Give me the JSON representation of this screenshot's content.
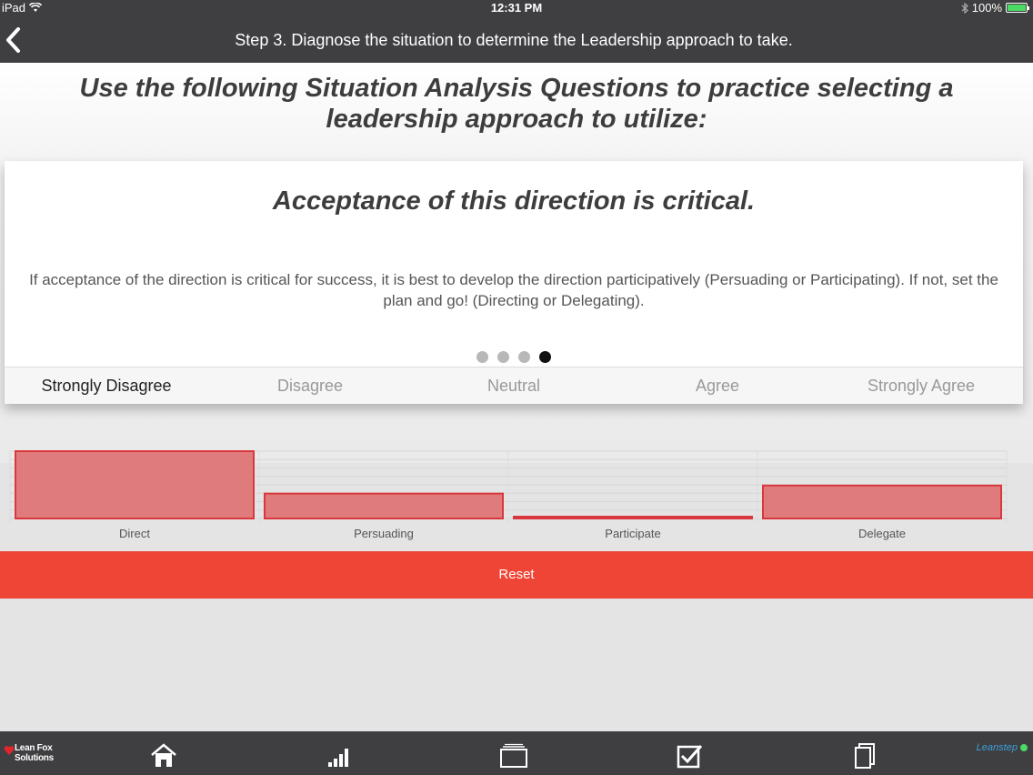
{
  "status_bar": {
    "device": "iPad",
    "time": "12:31 PM",
    "battery": "100%"
  },
  "nav": {
    "title": "Step 3. Diagnose the situation to determine the Leadership approach to take."
  },
  "headline": "Use the following Situation Analysis Questions to practice selecting a leadership approach to utilize:",
  "card": {
    "title": "Acceptance of this direction is critical.",
    "body": "If acceptance of the direction is critical for success, it is best to develop the direction participatively (Persuading or Participating). If not, set the plan and go! (Directing or Delegating).",
    "page_count": 4,
    "current_page": 4
  },
  "scale": {
    "options": [
      "Strongly Disagree",
      "Disagree",
      "Neutral",
      "Agree",
      "Strongly Agree"
    ],
    "selected": "Strongly Disagree"
  },
  "chart_data": {
    "type": "bar",
    "categories": [
      "Direct",
      "Persuading",
      "Participate",
      "Delegate"
    ],
    "values": [
      10,
      3.7,
      0.2,
      4.9
    ],
    "ylim": [
      0,
      10
    ],
    "grid": true,
    "bar_color": "#e07b7d",
    "bar_border": "#d9373d"
  },
  "reset_label": "Reset",
  "tabbar": {
    "logo_line1": "Lean Fox",
    "logo_line2": "Solutions",
    "brand_right": "Leanstep",
    "icons": [
      "home-icon",
      "stats-icon",
      "cards-icon",
      "checkbox-icon",
      "documents-icon"
    ]
  },
  "colors": {
    "accent": "#ef4536",
    "bar": "#3f3f41"
  }
}
